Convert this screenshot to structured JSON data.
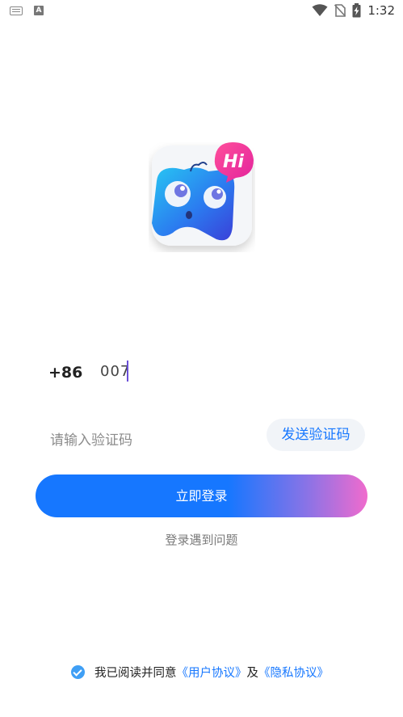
{
  "status_bar": {
    "time": "1:32",
    "left_icons": [
      "keyboard-icon",
      "a-icon"
    ],
    "right_icons": [
      "wifi-icon",
      "no-sim-icon",
      "battery-charging-icon"
    ]
  },
  "logo": {
    "badge_text": "Hi"
  },
  "phone": {
    "country_code": "+86",
    "value": "007"
  },
  "code": {
    "placeholder": "请输入验证码",
    "send_label": "发送验证码"
  },
  "login": {
    "label": "立即登录",
    "help_label": "登录遇到问题"
  },
  "agreement": {
    "checked": true,
    "prefix": "我已阅读并同意",
    "user_agreement": "《用户协议》",
    "conjunction": "及",
    "privacy_policy": "《隐私协议》"
  },
  "colors": {
    "accent": "#1677ff",
    "gradient_end": "#f06bcd",
    "check": "#3f9ff5"
  }
}
